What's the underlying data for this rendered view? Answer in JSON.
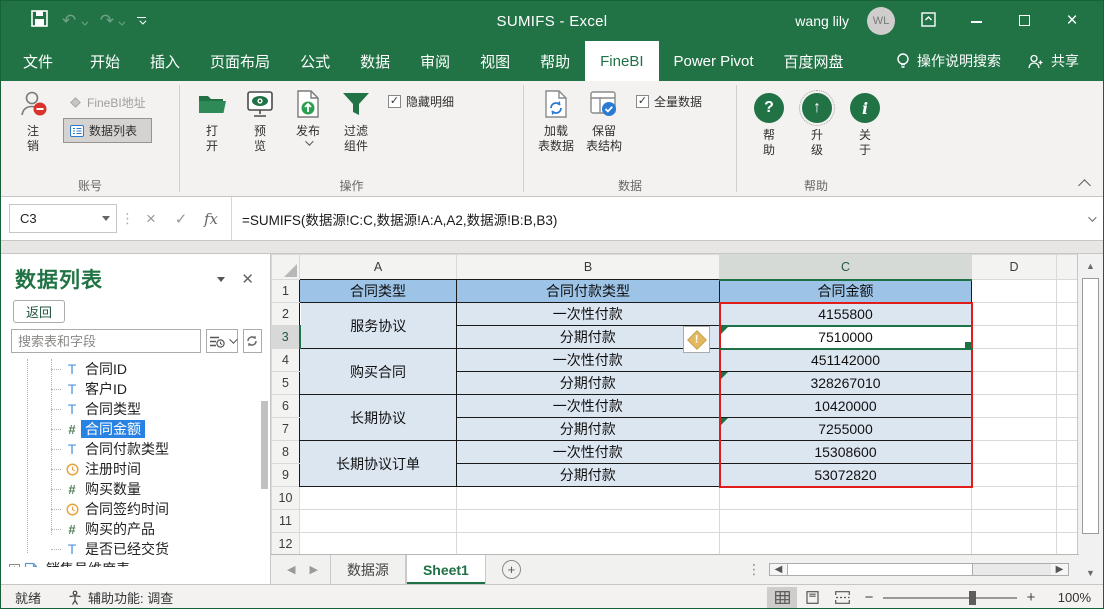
{
  "titlebar": {
    "title": "SUMIFS  -  Excel",
    "user": "wang lily",
    "avatar": "WL"
  },
  "ribbon_tabs": [
    "文件",
    "开始",
    "插入",
    "页面布局",
    "公式",
    "数据",
    "审阅",
    "视图",
    "帮助",
    "FineBI",
    "Power Pivot",
    "百度网盘"
  ],
  "ribbon_right": {
    "tell_me": "操作说明搜索",
    "share": "共享"
  },
  "ribbon": {
    "account": {
      "label": "账号",
      "logout": "注\n销",
      "address": "FineBI地址",
      "data_list": "数据列表"
    },
    "ops": {
      "label": "操作",
      "open": "打\n开",
      "preview": "预\n览",
      "publish": "发布",
      "filter": "过滤\n组件",
      "hide_detail": "隐藏明细"
    },
    "data": {
      "label": "数据",
      "load": "加载\n表数据",
      "keep": "保留\n表结构",
      "full": "全量数据"
    },
    "help": {
      "label": "帮助",
      "help": "帮\n助",
      "upgrade": "升\n级",
      "about": "关\n于"
    }
  },
  "formula_bar": {
    "name_box": "C3",
    "formula": "=SUMIFS(数据源!C:C,数据源!A:A,A2,数据源!B:B,B3)"
  },
  "panel": {
    "title": "数据列表",
    "back": "返回",
    "search_placeholder": "搜索表和字段",
    "fields": [
      {
        "icon": "text-field-icon",
        "label": "合同ID"
      },
      {
        "icon": "text-field-icon",
        "label": "客户ID"
      },
      {
        "icon": "text-field-icon",
        "label": "合同类型"
      },
      {
        "icon": "number-field-icon",
        "label": "合同金额",
        "selected": true
      },
      {
        "icon": "text-field-icon",
        "label": "合同付款类型"
      },
      {
        "icon": "time-field-icon",
        "label": "注册时间"
      },
      {
        "icon": "number-field-icon",
        "label": "购买数量"
      },
      {
        "icon": "time-field-icon",
        "label": "合同签约时间"
      },
      {
        "icon": "number-field-icon",
        "label": "购买的产品"
      },
      {
        "icon": "text-field-icon",
        "label": "是否已经交货"
      }
    ],
    "table_node": "销售员维度表"
  },
  "sheet": {
    "col_headers": [
      "A",
      "B",
      "C",
      "D"
    ],
    "row_headers": [
      "1",
      "2",
      "3",
      "4",
      "5",
      "6",
      "7",
      "8",
      "9",
      "10",
      "11",
      "12"
    ],
    "header_row": {
      "a": "合同类型",
      "b": "合同付款类型",
      "c": "合同金额"
    },
    "merged": [
      "服务协议",
      "购买合同",
      "长期协议",
      "长期协议订单"
    ],
    "rows": [
      {
        "b": "一次性付款",
        "c": "4155800"
      },
      {
        "b": "分期付款",
        "c": "7510000"
      },
      {
        "b": "一次性付款",
        "c": "451142000"
      },
      {
        "b": "分期付款",
        "c": "328267010"
      },
      {
        "b": "一次性付款",
        "c": "10420000"
      },
      {
        "b": "分期付款",
        "c": "7255000"
      },
      {
        "b": "一次性付款",
        "c": "15308600"
      },
      {
        "b": "分期付款",
        "c": "53072820"
      }
    ],
    "active_cell": "C3"
  },
  "sheet_tabs": {
    "tabs": [
      "数据源",
      "Sheet1"
    ],
    "active": "Sheet1"
  },
  "status_bar": {
    "mode": "就绪",
    "accessibility": "辅助功能: 调查",
    "zoom": "100%"
  },
  "colors": {
    "excel_green": "#217346",
    "header_fill": "#9DC3E6",
    "cell_fill": "#DCE6F1",
    "red_border": "#E21B1B",
    "selection_blue": "#2782E3",
    "active_cell_green": "#1E7145"
  }
}
